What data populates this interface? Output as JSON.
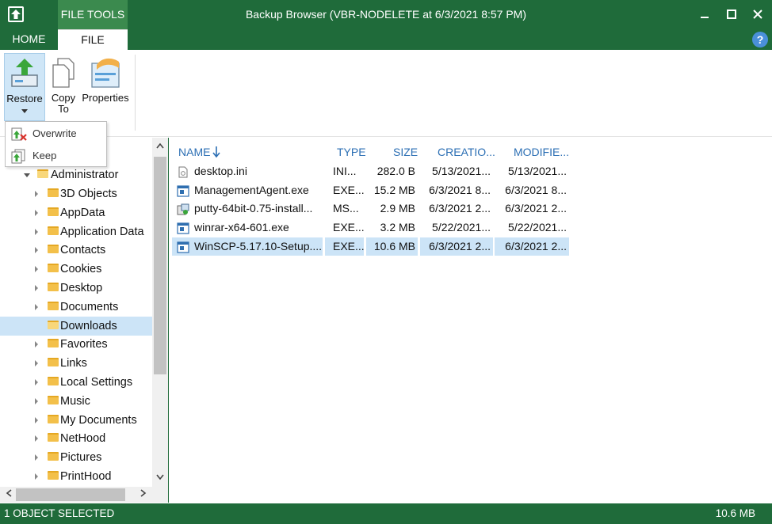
{
  "window": {
    "title": "Backup Browser (VBR-NODELETE at 6/3/2021 8:57 PM)",
    "context_tab": "FILE TOOLS",
    "accent_color": "#1f6b3a"
  },
  "tabs": {
    "home": "HOME",
    "file": "FILE"
  },
  "help": "?",
  "ribbon": {
    "restore_label": "Restore",
    "copy_to_label_1": "Copy",
    "copy_to_label_2": "To",
    "properties_label": "Properties",
    "restore_menu": {
      "overwrite": "Overwrite",
      "keep": "Keep"
    }
  },
  "tree": {
    "root": "Administrator",
    "items": [
      "3D Objects",
      "AppData",
      "Application Data",
      "Contacts",
      "Cookies",
      "Desktop",
      "Documents",
      "Downloads",
      "Favorites",
      "Links",
      "Local Settings",
      "Music",
      "My Documents",
      "NetHood",
      "Pictures",
      "PrintHood"
    ],
    "selected": "Downloads"
  },
  "files": {
    "columns": {
      "name": "NAME",
      "type": "TYPE",
      "size": "SIZE",
      "created": "CREATIO...",
      "modified": "MODIFIE..."
    },
    "rows": [
      {
        "name": "desktop.ini",
        "type": "INI...",
        "size": "282.0 B",
        "created": "5/13/2021...",
        "modified": "5/13/2021...",
        "icon": "ini-file-icon"
      },
      {
        "name": "ManagementAgent.exe",
        "type": "EXE...",
        "size": "15.2 MB",
        "created": "6/3/2021 8...",
        "modified": "6/3/2021 8...",
        "icon": "exe-file-icon"
      },
      {
        "name": "putty-64bit-0.75-install...",
        "type": "MS...",
        "size": "2.9 MB",
        "created": "6/3/2021 2...",
        "modified": "6/3/2021 2...",
        "icon": "msi-installer-icon"
      },
      {
        "name": "winrar-x64-601.exe",
        "type": "EXE...",
        "size": "3.2 MB",
        "created": "5/22/2021...",
        "modified": "5/22/2021...",
        "icon": "exe-file-icon"
      },
      {
        "name": "WinSCP-5.17.10-Setup....",
        "type": "EXE...",
        "size": "10.6 MB",
        "created": "6/3/2021 2...",
        "modified": "6/3/2021 2...",
        "icon": "exe-file-icon"
      }
    ],
    "selected_index": 4
  },
  "status": {
    "left": "1 OBJECT SELECTED",
    "right": "10.6 MB"
  }
}
